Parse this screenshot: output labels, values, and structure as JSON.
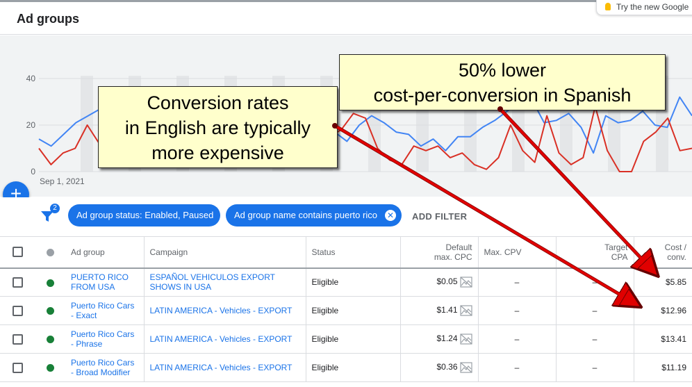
{
  "header": {
    "title": "Ad groups",
    "promo_text": "Try the new Google"
  },
  "chart_data": {
    "type": "line",
    "ylim": [
      0,
      40
    ],
    "yticks": [
      "40",
      "20",
      "0"
    ],
    "x_start_label": "Sep 1, 2021",
    "series": [
      {
        "color": "#4285f4",
        "values": [
          14,
          11,
          16,
          21,
          24,
          27,
          30,
          26,
          29,
          27,
          25,
          30,
          31,
          28,
          25,
          22,
          19,
          28,
          34,
          31,
          26,
          24,
          21,
          14,
          17,
          13,
          20,
          24,
          21,
          17,
          16,
          11,
          14,
          9,
          15,
          15,
          19,
          22,
          26,
          29,
          31,
          21,
          22,
          25,
          19,
          8,
          24,
          21,
          22,
          26,
          20,
          19,
          32,
          24
        ]
      },
      {
        "color": "#d93025",
        "values": [
          10,
          3,
          8,
          10,
          20,
          12,
          9,
          4,
          8,
          2,
          5,
          9,
          11,
          18,
          24,
          16,
          9,
          4,
          8,
          13,
          8,
          3,
          6,
          12,
          15,
          18,
          25,
          23,
          10,
          5,
          3,
          11,
          9,
          11,
          6,
          8,
          3,
          1,
          6,
          20,
          9,
          4,
          24,
          8,
          3,
          6,
          28,
          9,
          0,
          0,
          13,
          17,
          23,
          9,
          10
        ]
      }
    ]
  },
  "fab": {
    "label": "+"
  },
  "filters": {
    "count": "2",
    "chips": [
      {
        "label": "Ad group status: Enabled, Paused"
      },
      {
        "label": "Ad group name contains puerto rico",
        "remove": "✕"
      }
    ],
    "add_filter": "ADD FILTER"
  },
  "table": {
    "headers": {
      "ad_group": "Ad group",
      "campaign": "Campaign",
      "status": "Status",
      "default_max_cpc_1": "Default",
      "default_max_cpc_2": "max. CPC",
      "max_cpv": "Max. CPV",
      "target_cpa_1": "Target",
      "target_cpa_2": "CPA",
      "cost_conv_1": "Cost /",
      "cost_conv_2": "conv."
    },
    "rows": [
      {
        "ad_group": "PUERTO RICO FROM USA",
        "campaign": "ESPAÑOL VEHICULOS EXPORT SHOWS IN USA",
        "status": "Eligible",
        "max_cpc": "$0.05",
        "max_cpv": "–",
        "target_cpa": "–",
        "cost_conv": "$5.85"
      },
      {
        "ad_group": "Puerto Rico Cars - Exact",
        "campaign": "LATIN AMERICA - Vehicles - EXPORT",
        "status": "Eligible",
        "max_cpc": "$1.41",
        "max_cpv": "–",
        "target_cpa": "–",
        "cost_conv": "$12.96"
      },
      {
        "ad_group": "Puerto Rico Cars - Phrase",
        "campaign": "LATIN AMERICA - Vehicles - EXPORT",
        "status": "Eligible",
        "max_cpc": "$1.24",
        "max_cpv": "–",
        "target_cpa": "–",
        "cost_conv": "$13.41"
      },
      {
        "ad_group": "Puerto Rico Cars - Broad Modifier",
        "campaign": "LATIN AMERICA - Vehicles - EXPORT",
        "status": "Eligible",
        "max_cpc": "$0.36",
        "max_cpv": "–",
        "target_cpa": "–",
        "cost_conv": "$11.19"
      }
    ]
  },
  "callouts": {
    "english": [
      "Conversion rates",
      "in English are typically",
      "more expensive"
    ],
    "spanish": [
      "50% lower",
      "cost-per-conversion in Spanish"
    ]
  },
  "colors": {
    "accent": "#1a73e8",
    "status_enabled": "#188038",
    "annotation_bg": "#ffffcc",
    "arrow": "#e00000"
  }
}
